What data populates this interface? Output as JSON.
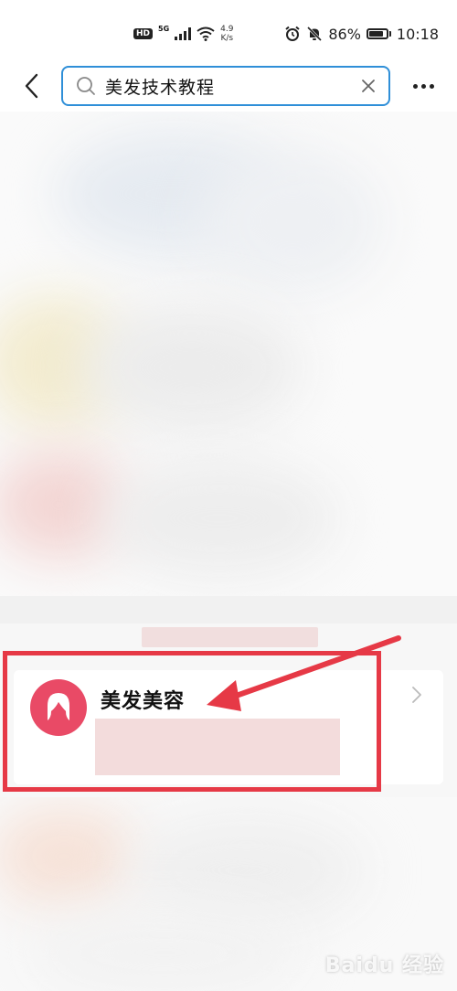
{
  "status_bar": {
    "hd": "HD",
    "network": "5G",
    "speed_value": "4.9",
    "speed_unit": "K/s",
    "battery_text": "86%",
    "battery_level": 0.86,
    "time": "10:18"
  },
  "search": {
    "query": "美发技术教程"
  },
  "result": {
    "category_title": "美发美容"
  },
  "watermark": {
    "text": "Baidu 经验"
  },
  "colors": {
    "accent": "#2f8fd8",
    "avatar": "#e94a66",
    "annotation": "#e63946"
  },
  "icons": [
    "back-arrow-icon",
    "search-icon",
    "clear-icon",
    "more-icon",
    "alarm-icon",
    "mute-bell-icon",
    "wifi-icon",
    "signal-icon",
    "battery-icon",
    "female-avatar-icon",
    "chevron-right-icon"
  ]
}
